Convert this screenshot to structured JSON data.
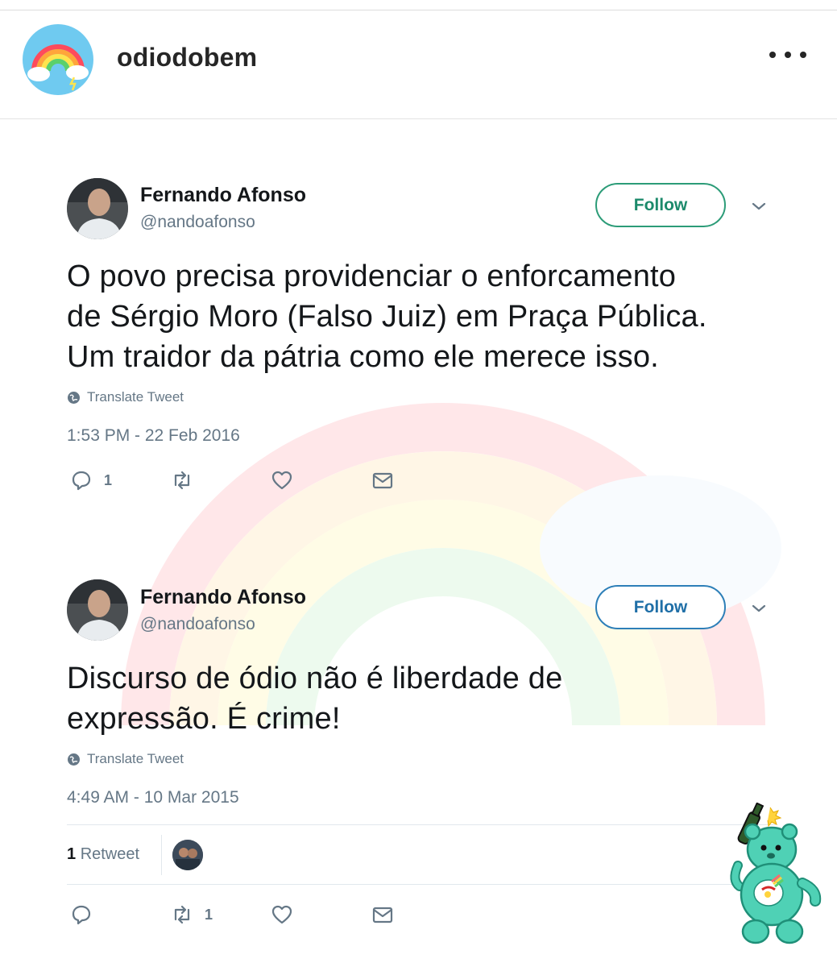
{
  "post_header": {
    "username": "odiodobem",
    "avatar_icon": "rainbow-cloud-icon",
    "more_icon": "more-dots-icon"
  },
  "tweets": [
    {
      "name": "Fernando Afonso",
      "handle": "@nandoafonso",
      "follow_label": "Follow",
      "text_lines": [
        "O povo precisa providenciar o enforcamento",
        "de Sérgio Moro (Falso Juiz) em Praça Pública.",
        "Um traidor da pátria como ele merece isso."
      ],
      "translate_label": "Translate Tweet",
      "timestamp": "1:53 PM - 22 Feb 2016",
      "reply_count": "1",
      "retweet_count": "",
      "follow_color": "#2c9c78"
    },
    {
      "name": "Fernando Afonso",
      "handle": "@nandoafonso",
      "follow_label": "Follow",
      "text_lines": [
        "Discurso de ódio não é liberdade de",
        "expressão. É crime!"
      ],
      "translate_label": "Translate Tweet",
      "timestamp": "4:49 AM - 10 Mar 2015",
      "retweets_number": "1",
      "retweets_label": "Retweet",
      "reply_count": "",
      "retweet_count": "1",
      "follow_color": "#2d7fb8"
    }
  ],
  "colors": {
    "text": "#14171a",
    "secondary": "#657786",
    "bear": "#4fd1b5"
  }
}
